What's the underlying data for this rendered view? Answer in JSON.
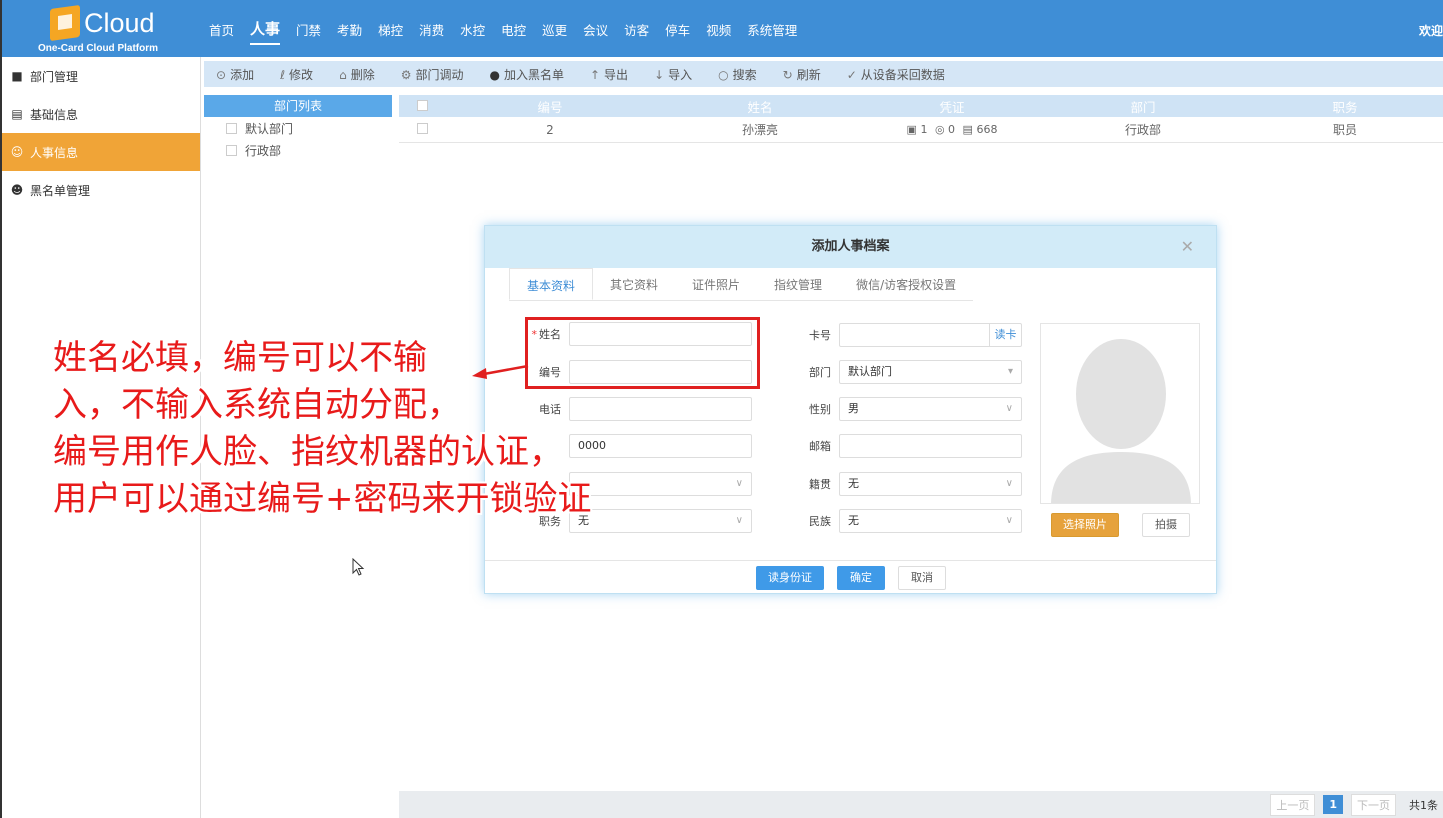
{
  "header": {
    "logo_text": "Cloud",
    "logo_sub": "One-Card Cloud Platform",
    "nav": [
      "首页",
      "人事",
      "门禁",
      "考勤",
      "梯控",
      "消费",
      "水控",
      "电控",
      "巡更",
      "会议",
      "访客",
      "停车",
      "视频",
      "系统管理"
    ],
    "active_nav": "人事",
    "welcome": "欢迎"
  },
  "sidebar": {
    "items": [
      {
        "label": "部门管理",
        "icon": "people-icon"
      },
      {
        "label": "基础信息",
        "icon": "list-icon"
      },
      {
        "label": "人事信息",
        "icon": "person-icon",
        "active": true
      },
      {
        "label": "黑名单管理",
        "icon": "blacklist-icon"
      }
    ]
  },
  "toolbar": {
    "add": "添加",
    "edit": "修改",
    "delete": "删除",
    "transfer": "部门调动",
    "blacklist": "加入黑名单",
    "export": "导出",
    "import": "导入",
    "search": "搜索",
    "refresh": "刷新",
    "fetch": "从设备采回数据"
  },
  "dept_panel": {
    "title": "部门列表",
    "items": [
      "默认部门",
      "行政部"
    ]
  },
  "grid": {
    "headers": [
      "编号",
      "姓名",
      "凭证",
      "部门",
      "职务"
    ],
    "rows": [
      {
        "id": "2",
        "name": "孙漂亮",
        "face": "1",
        "fp": "0",
        "card": "668",
        "dept": "行政部",
        "position": "职员"
      }
    ]
  },
  "pager": {
    "prev": "上一页",
    "page": "1",
    "next": "下一页",
    "total": "共1条"
  },
  "modal": {
    "title": "添加人事档案",
    "tabs": [
      "基本资料",
      "其它资料",
      "证件照片",
      "指纹管理",
      "微信/访客授权设置"
    ],
    "fields": {
      "name_label": "姓名",
      "id_label": "编号",
      "phone_label": "电话",
      "password_value": "0000",
      "position_label": "职务",
      "position_value": "无",
      "card_label": "卡号",
      "read_card": "读卡",
      "dept_label": "部门",
      "dept_value": "默认部门",
      "gender_label": "性别",
      "gender_value": "男",
      "email_label": "邮箱",
      "origin_label": "籍贯",
      "origin_value": "无",
      "nation_label": "民族",
      "nation_value": "无"
    },
    "buttons": {
      "choose_photo": "选择照片",
      "capture": "拍摄",
      "read_id": "读身份证",
      "confirm": "确定",
      "cancel": "取消"
    }
  },
  "annotation": {
    "lines": [
      "姓名必填，编号可以不输",
      "入，不输入系统自动分配，",
      "编号用作人脸、指纹机器的认证，",
      "用户可以通过编号+密码来开锁验证"
    ]
  }
}
